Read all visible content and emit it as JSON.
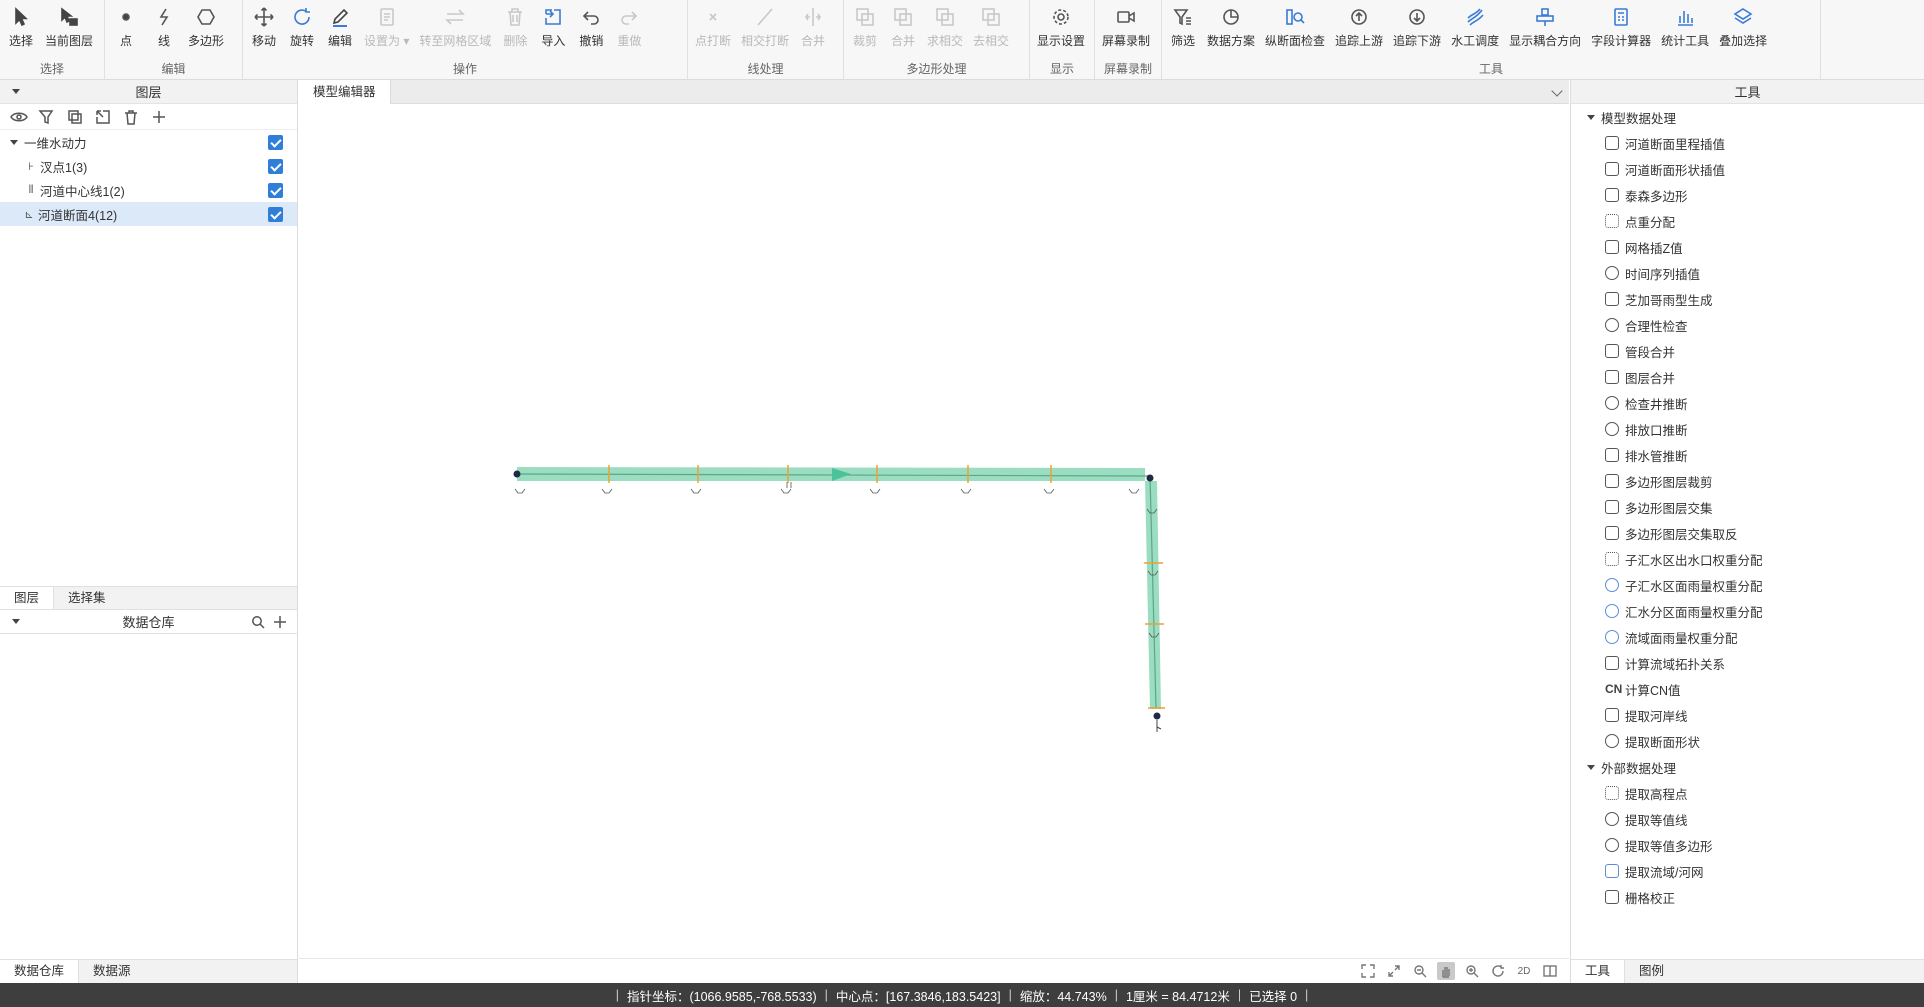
{
  "ribbon": {
    "groups": [
      {
        "label": "选择",
        "tools": [
          {
            "label": "选择",
            "icon": "cursor-icon"
          },
          {
            "label": "当前图层",
            "icon": "layer-cursor-icon"
          }
        ]
      },
      {
        "label": "编辑",
        "tools": [
          {
            "label": "点",
            "icon": "point-icon"
          },
          {
            "label": "线",
            "icon": "line-icon"
          },
          {
            "label": "多边形",
            "icon": "polygon-icon"
          }
        ]
      },
      {
        "label": "操作",
        "tools": [
          {
            "label": "移动",
            "icon": "move-icon"
          },
          {
            "label": "旋转",
            "icon": "rotate-icon"
          },
          {
            "label": "编辑",
            "icon": "pencil-icon"
          },
          {
            "label": "设置为",
            "icon": "set-as-icon",
            "disabled": true
          },
          {
            "label": "转至网格区域",
            "icon": "swap-icon",
            "disabled": true
          },
          {
            "label": "删除",
            "icon": "trash-icon",
            "disabled": true
          },
          {
            "label": "导入",
            "icon": "import-icon"
          },
          {
            "label": "撤销",
            "icon": "undo-icon"
          },
          {
            "label": "重做",
            "icon": "redo-icon",
            "disabled": true
          }
        ]
      },
      {
        "label": "线处理",
        "tools": [
          {
            "label": "点打断",
            "icon": "point-break-icon",
            "disabled": true
          },
          {
            "label": "相交打断",
            "icon": "intersect-break-icon",
            "disabled": true
          },
          {
            "label": "合并",
            "icon": "line-merge-icon",
            "disabled": true
          }
        ]
      },
      {
        "label": "多边形处理",
        "tools": [
          {
            "label": "裁剪",
            "icon": "clip-icon",
            "disabled": true
          },
          {
            "label": "合并",
            "icon": "poly-merge-icon",
            "disabled": true
          },
          {
            "label": "求相交",
            "icon": "intersect-icon",
            "disabled": true
          },
          {
            "label": "去相交",
            "icon": "remove-intersect-icon",
            "disabled": true
          }
        ]
      },
      {
        "label": "显示",
        "tools": [
          {
            "label": "显示设置",
            "icon": "gear-icon"
          }
        ]
      },
      {
        "label": "屏幕录制",
        "tools": [
          {
            "label": "屏幕录制",
            "icon": "video-icon"
          }
        ]
      },
      {
        "label": "工具",
        "tools": [
          {
            "label": "筛选",
            "icon": "filter-icon"
          },
          {
            "label": "数据方案",
            "icon": "pie-icon"
          },
          {
            "label": "纵断面检查",
            "icon": "profile-check-icon"
          },
          {
            "label": "追踪上游",
            "icon": "trace-up-icon"
          },
          {
            "label": "追踪下游",
            "icon": "trace-down-icon"
          },
          {
            "label": "水工调度",
            "icon": "dispatch-icon"
          },
          {
            "label": "显示耦合方向",
            "icon": "coupling-icon"
          },
          {
            "label": "字段计算器",
            "icon": "calculator-icon"
          },
          {
            "label": "统计工具",
            "icon": "stats-icon"
          },
          {
            "label": "叠加选择",
            "icon": "stack-icon"
          }
        ]
      }
    ]
  },
  "left": {
    "layers_title": "图层",
    "tree": [
      {
        "label": "一维水动力",
        "kind": "group"
      },
      {
        "label": "汊点1(3)",
        "icon": "junction-icon"
      },
      {
        "label": "河道中心线1(2)",
        "icon": "centerline-icon"
      },
      {
        "label": "河道断面4(12)",
        "icon": "section-icon",
        "selected": true
      }
    ],
    "tabs": [
      "图层",
      "选择集"
    ],
    "warehouse_title": "数据仓库",
    "bottom_tabs": [
      "数据仓库",
      "数据源"
    ]
  },
  "center": {
    "doc_tab": "模型编辑器"
  },
  "right": {
    "title": "工具",
    "sections": [
      {
        "label": "模型数据处理",
        "items": [
          {
            "label": "河道断面里程插值",
            "icon": "section-interp-icon"
          },
          {
            "label": "河道断面形状插值",
            "icon": "shape-interp-icon"
          },
          {
            "label": "泰森多边形",
            "icon": "voronoi-icon"
          },
          {
            "label": "点重分配",
            "icon": "point-redistribute-icon"
          },
          {
            "label": "网格插Z值",
            "icon": "grid-icon"
          },
          {
            "label": "时间序列插值",
            "icon": "clock-icon"
          },
          {
            "label": "芝加哥雨型生成",
            "icon": "rain-icon"
          },
          {
            "label": "合理性检查",
            "icon": "check-icon"
          },
          {
            "label": "管段合并",
            "icon": "pipe-merge-icon"
          },
          {
            "label": "图层合并",
            "icon": "layer-merge-icon"
          },
          {
            "label": "检查井推断",
            "icon": "manhole-icon"
          },
          {
            "label": "排放口推断",
            "icon": "outfall-icon"
          },
          {
            "label": "排水管推断",
            "icon": "drain-pipe-icon"
          },
          {
            "label": "多边形图层裁剪",
            "icon": "poly-clip-icon"
          },
          {
            "label": "多边形图层交集",
            "icon": "poly-intersect-icon"
          },
          {
            "label": "多边形图层交集取反",
            "icon": "poly-inverse-icon"
          },
          {
            "label": "子汇水区出水口权重分配",
            "icon": "outlet-weight-icon"
          },
          {
            "label": "子汇水区面雨量权重分配",
            "icon": "sub-rain-weight-icon"
          },
          {
            "label": "汇水分区面雨量权重分配",
            "icon": "zone-rain-weight-icon"
          },
          {
            "label": "流域面雨量权重分配",
            "icon": "basin-rain-weight-icon"
          },
          {
            "label": "计算流域拓扑关系",
            "icon": "topology-icon"
          },
          {
            "label": "计算CN值",
            "icon": "cn-icon"
          },
          {
            "label": "提取河岸线",
            "icon": "bank-icon"
          },
          {
            "label": "提取断面形状",
            "icon": "extract-section-icon"
          }
        ]
      },
      {
        "label": "外部数据处理",
        "items": [
          {
            "label": "提取高程点",
            "icon": "elevation-point-icon"
          },
          {
            "label": "提取等值线",
            "icon": "contour-icon"
          },
          {
            "label": "提取等值多边形",
            "icon": "contour-poly-icon"
          },
          {
            "label": "提取流域/河网",
            "icon": "basin-icon"
          },
          {
            "label": "栅格校正",
            "icon": "raster-icon"
          }
        ]
      }
    ],
    "bottom_tabs": [
      "工具",
      "图例"
    ]
  },
  "map_tools": [
    "全图",
    "缩放",
    "放大",
    "平移",
    "放大镜",
    "刷新",
    "2D",
    "分屏"
  ],
  "status": {
    "pointer": "指针坐标：(1066.9585,-768.5533)",
    "center": "中心点：[167.3846,183.5423]",
    "zoom": "缩放：44.743%",
    "scale": "1厘米 = 84.4712米",
    "selected": "已选择 0"
  },
  "colors": {
    "river_fill": "#8fd9b9",
    "section_line": "#f0a030",
    "node": "#1f2a44",
    "accent": "#2f7fd8"
  }
}
